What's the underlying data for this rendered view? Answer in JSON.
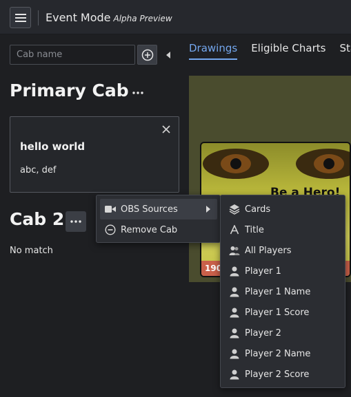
{
  "header": {
    "title": "Event Mode",
    "subtitle": "Alpha Preview"
  },
  "sidebar": {
    "cab_input_placeholder": "Cab name",
    "cabs": [
      {
        "name": "Primary Cab",
        "cards": [
          {
            "title": "hello world",
            "subtitle": "abc, def"
          }
        ]
      },
      {
        "name": "Cab 2",
        "empty_text": "No match"
      }
    ]
  },
  "tabs": [
    {
      "label": "Drawings",
      "active": true
    },
    {
      "label": "Eligible Charts",
      "active": false
    },
    {
      "label": "Start",
      "active": false
    }
  ],
  "preview": {
    "text": "Be a Hero!",
    "number": "190"
  },
  "context_menu": {
    "items": [
      {
        "label": "OBS Sources",
        "icon": "video-camera-icon",
        "has_submenu": true
      },
      {
        "label": "Remove Cab",
        "icon": "minus-circle-icon",
        "has_submenu": false
      }
    ]
  },
  "submenu": {
    "items": [
      {
        "label": "Cards",
        "icon": "layers-icon"
      },
      {
        "label": "Title",
        "icon": "text-icon"
      },
      {
        "label": "All Players",
        "icon": "people-icon"
      },
      {
        "label": "Player 1",
        "icon": "person-icon"
      },
      {
        "label": "Player 1 Name",
        "icon": "person-icon"
      },
      {
        "label": "Player 1 Score",
        "icon": "person-icon"
      },
      {
        "label": "Player 2",
        "icon": "person-icon"
      },
      {
        "label": "Player 2 Name",
        "icon": "person-icon"
      },
      {
        "label": "Player 2 Score",
        "icon": "person-icon"
      }
    ]
  },
  "colors": {
    "background": "#1e1f22",
    "accent": "#74a7ee",
    "menu_bg": "#2b2d32"
  }
}
